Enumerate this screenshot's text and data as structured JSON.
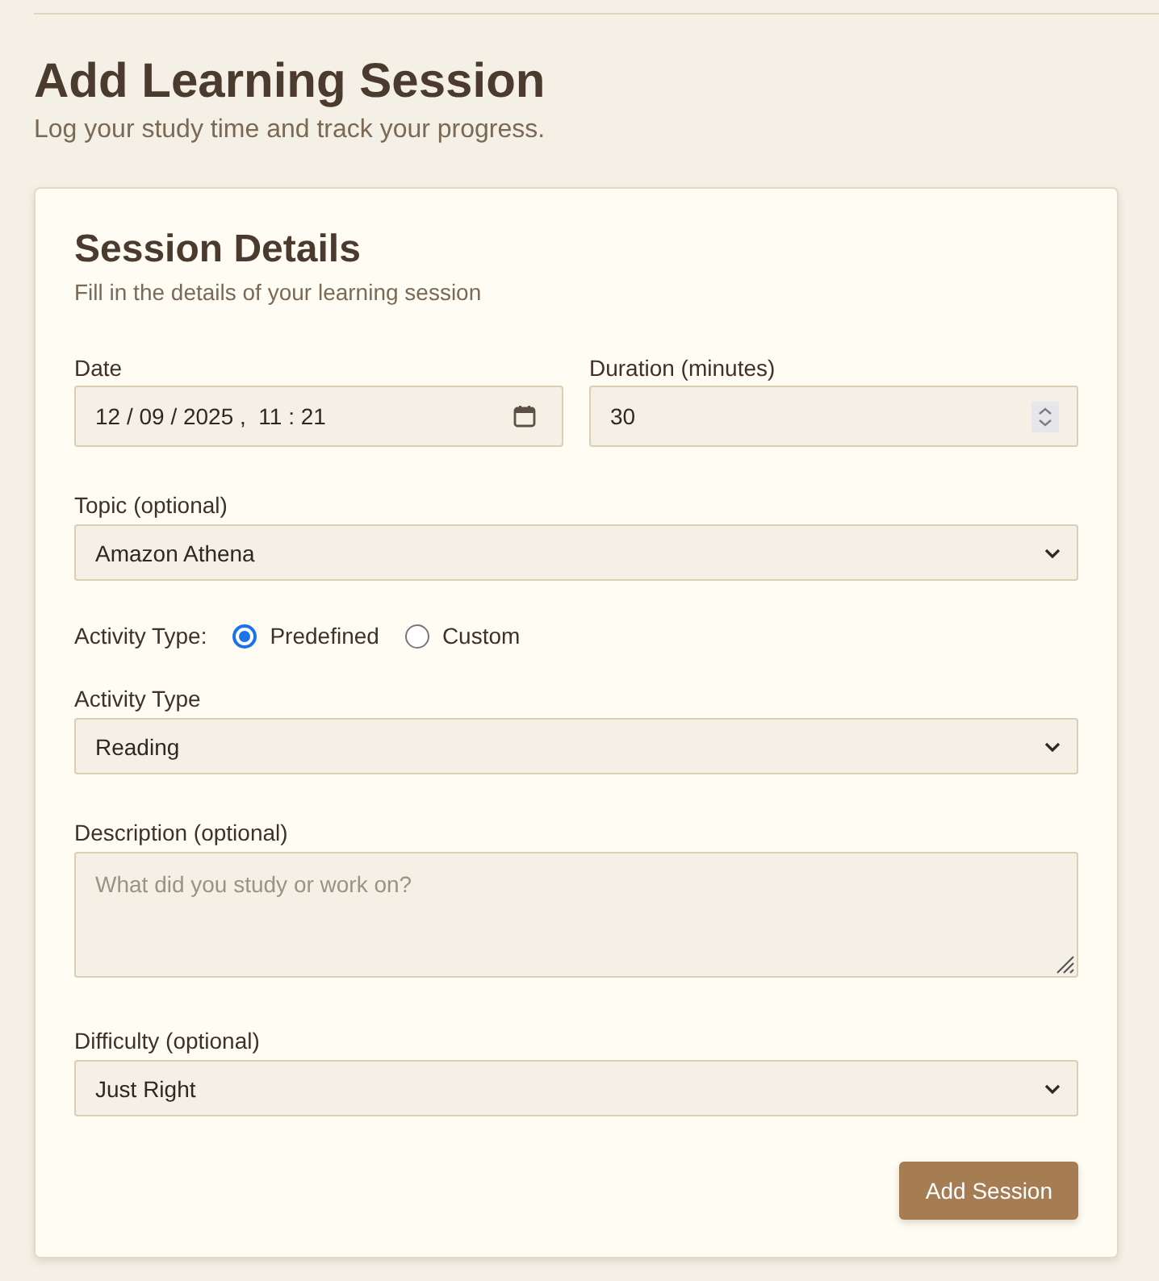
{
  "header": {
    "title": "Add Learning Session",
    "subtitle": "Log your study time and track your progress."
  },
  "card": {
    "title": "Session Details",
    "subtitle": "Fill in the details of your learning session"
  },
  "rows": [
    [
      {
        "kind": "date",
        "label": "Date",
        "value": "12 / 09 / 2025 ,  11 : 21"
      },
      {
        "kind": "number",
        "label": "Duration (minutes)",
        "value": "30"
      }
    ],
    [
      {
        "kind": "select",
        "label": "Topic (optional)",
        "value": "Amazon Athena"
      }
    ],
    [
      {
        "kind": "radio",
        "label": "Activity Type:",
        "options": [
          {
            "label": "Predefined",
            "selected": true
          },
          {
            "label": "Custom",
            "selected": false
          }
        ]
      }
    ],
    [
      {
        "kind": "select",
        "label": "Activity Type",
        "value": "Reading"
      }
    ],
    [
      {
        "kind": "textarea",
        "label": "Description (optional)",
        "placeholder": "What did you study or work on?"
      }
    ],
    [
      {
        "kind": "select",
        "label": "Difficulty (optional)",
        "value": "Just Right"
      }
    ]
  ],
  "submit": {
    "label": "Add Session"
  }
}
